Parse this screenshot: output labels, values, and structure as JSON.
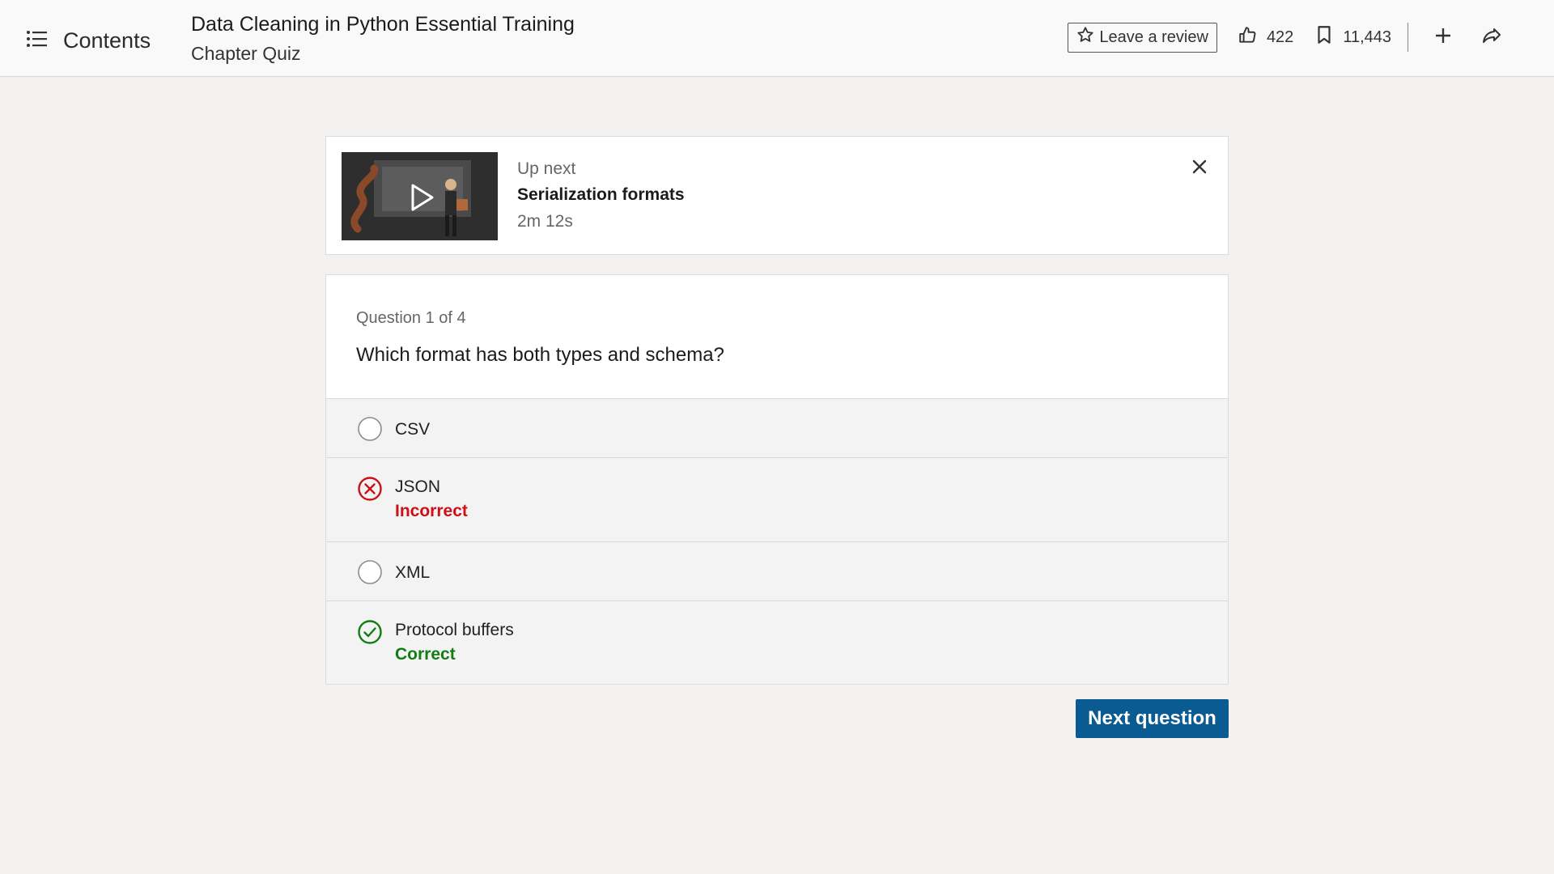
{
  "header": {
    "contents_label": "Contents",
    "course_title": "Data Cleaning in Python Essential Training",
    "course_subtitle": "Chapter Quiz",
    "review_label": "Leave a review",
    "likes": "422",
    "saves": "11,443",
    "icons": [
      "list-icon",
      "star-icon",
      "thumbs-up-icon",
      "bookmark-icon",
      "plus-icon",
      "share-icon"
    ]
  },
  "up_next": {
    "label": "Up next",
    "title": "Serialization formats",
    "duration": "2m 12s"
  },
  "quiz": {
    "counter": "Question 1 of 4",
    "question": "Which format has both types and schema?",
    "options": [
      {
        "label": "CSV",
        "state": "unselected",
        "status": ""
      },
      {
        "label": "JSON",
        "state": "incorrect",
        "status": "Incorrect"
      },
      {
        "label": "XML",
        "state": "unselected",
        "status": ""
      },
      {
        "label": "Protocol buffers",
        "state": "correct",
        "status": "Correct"
      }
    ],
    "next_label": "Next question"
  },
  "colors": {
    "accent": "#0a5b91",
    "incorrect": "#cc1016",
    "correct": "#127d12",
    "background": "#f3f2f0"
  }
}
